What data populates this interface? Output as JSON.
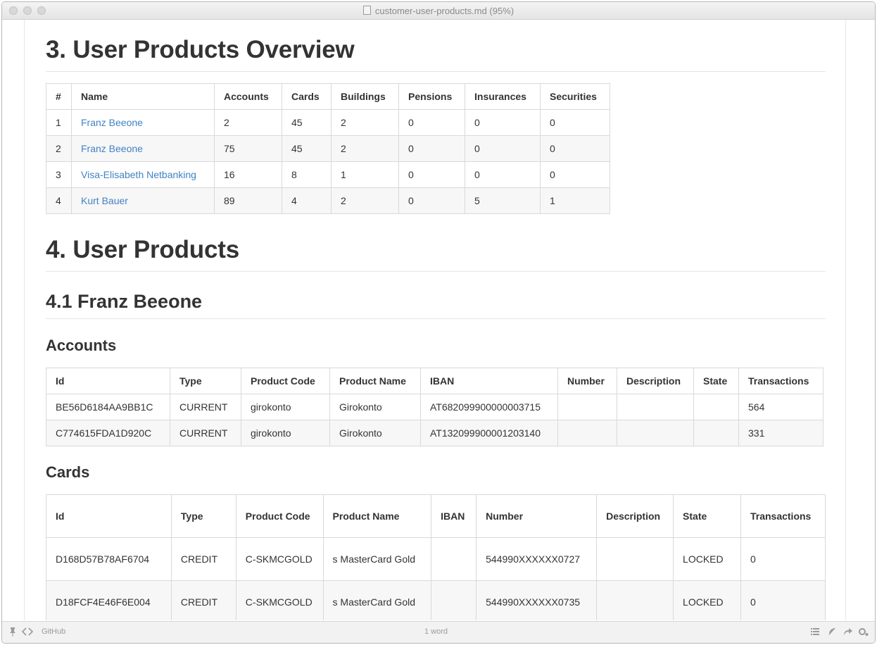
{
  "window": {
    "title": "customer-user-products.md (95%)"
  },
  "section3": {
    "heading": "3. User Products Overview",
    "columns": [
      "#",
      "Name",
      "Accounts",
      "Cards",
      "Buildings",
      "Pensions",
      "Insurances",
      "Securities"
    ],
    "rows": [
      [
        "1",
        "Franz Beeone",
        "2",
        "45",
        "2",
        "0",
        "0",
        "0"
      ],
      [
        "2",
        "Franz Beeone",
        "75",
        "45",
        "2",
        "0",
        "0",
        "0"
      ],
      [
        "3",
        "Visa-Elisabeth Netbanking",
        "16",
        "8",
        "1",
        "0",
        "0",
        "0"
      ],
      [
        "4",
        "Kurt Bauer",
        "89",
        "4",
        "2",
        "0",
        "5",
        "1"
      ]
    ]
  },
  "section4": {
    "heading": "4. User Products",
    "sub": "4.1 Franz Beeone",
    "accounts": {
      "heading": "Accounts",
      "columns": [
        "Id",
        "Type",
        "Product Code",
        "Product Name",
        "IBAN",
        "Number",
        "Description",
        "State",
        "Transactions"
      ],
      "rows": [
        [
          "BE56D6184AA9BB1C",
          "CURRENT",
          "girokonto",
          "Girokonto",
          "AT682099900000003715",
          "",
          "",
          "",
          "564"
        ],
        [
          "C774615FDA1D920C",
          "CURRENT",
          "girokonto",
          "Girokonto",
          "AT132099900001203140",
          "",
          "",
          "",
          "331"
        ]
      ]
    },
    "cards": {
      "heading": "Cards",
      "columns": [
        "Id",
        "Type",
        "Product Code",
        "Product Name",
        "IBAN",
        "Number",
        "Description",
        "State",
        "Transactions"
      ],
      "rows": [
        [
          "D168D57B78AF6704",
          "CREDIT",
          "C-SKMCGOLD",
          "s MasterCard Gold",
          "",
          "544990XXXXXX0727",
          "",
          "LOCKED",
          "0"
        ],
        [
          "D18FCF4E46F6E004",
          "CREDIT",
          "C-SKMCGOLD",
          "s MasterCard Gold",
          "",
          "544990XXXXXX0735",
          "",
          "LOCKED",
          "0"
        ]
      ]
    }
  },
  "statusbar": {
    "github": "GitHub",
    "word_count": "1 word"
  }
}
